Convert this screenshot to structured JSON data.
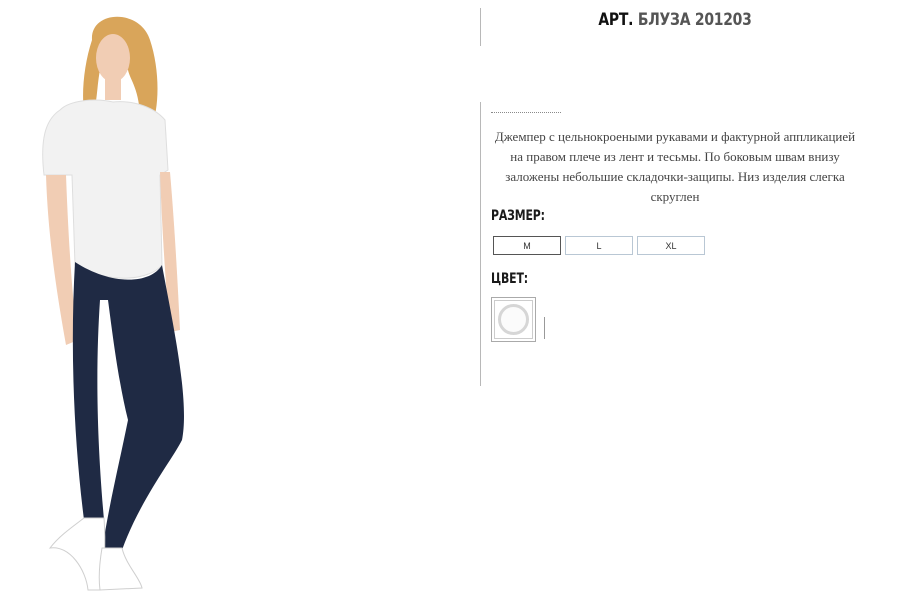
{
  "product": {
    "title_prefix": "АРТ.",
    "title_name": "БЛУЗА 201203",
    "description": "Джемпер с цельнокроеными рукавами и фактурной аппликацией на правом плече из лент и тесьмы. По боковым швам внизу заложены небольшие складочки-защипы. Низ изделия слегка скруглен"
  },
  "size": {
    "label": "РАЗМЕР:",
    "options": [
      "M",
      "L",
      "XL"
    ],
    "selected": "M"
  },
  "color": {
    "label": "ЦВЕТ:",
    "swatch": "white"
  },
  "colors": {
    "jeans": "#1f2a44",
    "top": "#f2f2f2",
    "hair": "#d9a55a",
    "skin": "#f1cdb4"
  }
}
